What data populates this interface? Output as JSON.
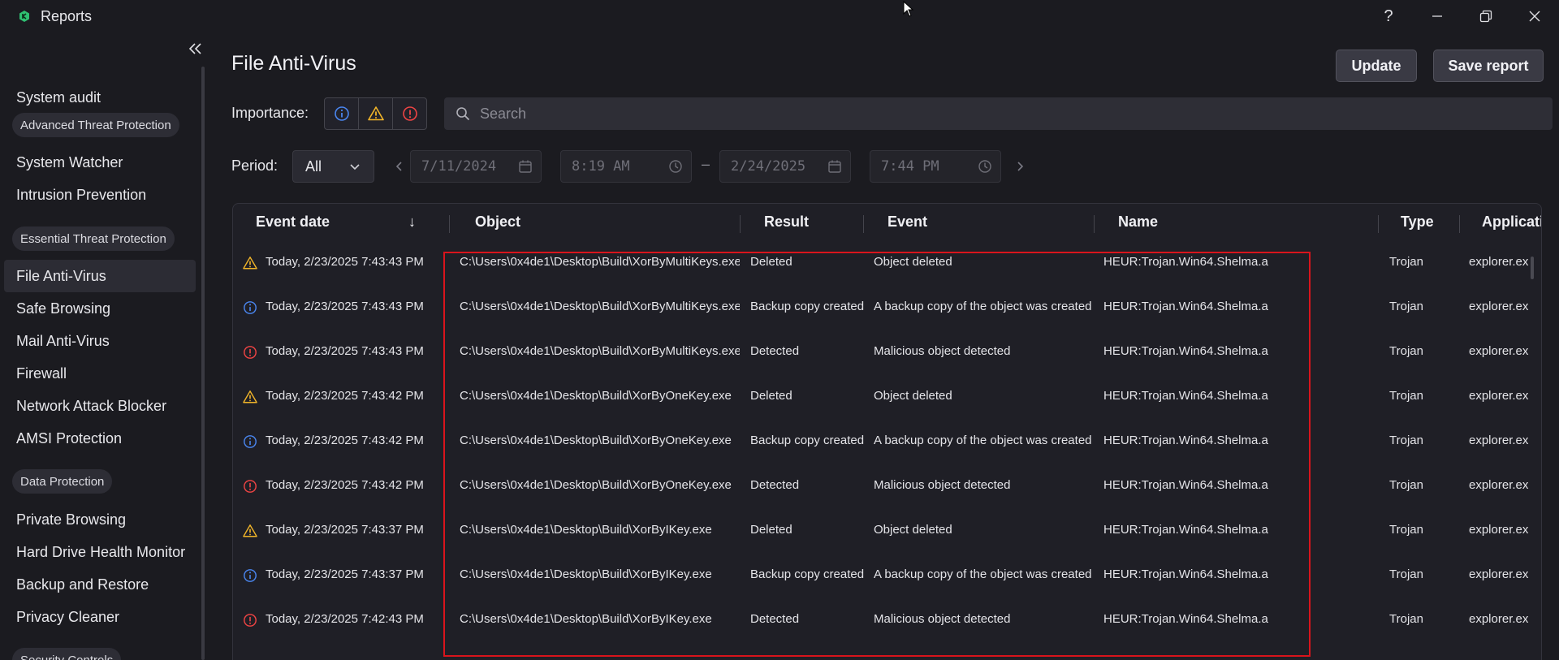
{
  "window": {
    "title": "Reports",
    "help_label": "?"
  },
  "sidebar": {
    "items": [
      {
        "label": "System audit"
      },
      {
        "section": "Advanced Threat Protection"
      },
      {
        "label": "System Watcher"
      },
      {
        "label": "Intrusion Prevention"
      },
      {
        "section": "Essential Threat Protection"
      },
      {
        "label": "File Anti-Virus",
        "active": true
      },
      {
        "label": "Safe Browsing"
      },
      {
        "label": "Mail Anti-Virus"
      },
      {
        "label": "Firewall"
      },
      {
        "label": "Network Attack Blocker"
      },
      {
        "label": "AMSI Protection"
      },
      {
        "section": "Data Protection"
      },
      {
        "label": "Private Browsing"
      },
      {
        "label": "Hard Drive Health Monitor"
      },
      {
        "label": "Backup and Restore"
      },
      {
        "label": "Privacy Cleaner"
      },
      {
        "section": "Security Controls"
      }
    ]
  },
  "main": {
    "title": "File Anti-Virus",
    "update_label": "Update",
    "save_report_label": "Save report",
    "importance_label": "Importance:",
    "search_placeholder": "Search",
    "period_label": "Period:",
    "period_value": "All",
    "date_from": "7/11/2024",
    "time_from": "8:19 AM",
    "date_separator": "–",
    "date_to": "2/24/2025",
    "time_to": "7:44 PM"
  },
  "table": {
    "columns": [
      "Event date",
      "Object",
      "Result",
      "Event",
      "Name",
      "Type",
      "Applicati"
    ],
    "sort_indicator": "↓",
    "rows": [
      {
        "level": "warning",
        "date": "Today, 2/23/2025 7:43:43 PM",
        "object": "C:\\Users\\0x4de1\\Desktop\\Build\\XorByMultiKeys.exe",
        "result": "Deleted",
        "event": "Object deleted",
        "name": "HEUR:Trojan.Win64.Shelma.a",
        "type": "Trojan",
        "app": "explorer.exe"
      },
      {
        "level": "info",
        "date": "Today, 2/23/2025 7:43:43 PM",
        "object": "C:\\Users\\0x4de1\\Desktop\\Build\\XorByMultiKeys.exe",
        "result": "Backup copy created",
        "event": "A backup copy of the object was created",
        "name": "HEUR:Trojan.Win64.Shelma.a",
        "type": "Trojan",
        "app": "explorer.exe"
      },
      {
        "level": "critical",
        "date": "Today, 2/23/2025 7:43:43 PM",
        "object": "C:\\Users\\0x4de1\\Desktop\\Build\\XorByMultiKeys.exe",
        "result": "Detected",
        "event": "Malicious object detected",
        "name": "HEUR:Trojan.Win64.Shelma.a",
        "type": "Trojan",
        "app": "explorer.exe"
      },
      {
        "level": "warning",
        "date": "Today, 2/23/2025 7:43:42 PM",
        "object": "C:\\Users\\0x4de1\\Desktop\\Build\\XorByOneKey.exe",
        "result": "Deleted",
        "event": "Object deleted",
        "name": "HEUR:Trojan.Win64.Shelma.a",
        "type": "Trojan",
        "app": "explorer.exe"
      },
      {
        "level": "info",
        "date": "Today, 2/23/2025 7:43:42 PM",
        "object": "C:\\Users\\0x4de1\\Desktop\\Build\\XorByOneKey.exe",
        "result": "Backup copy created",
        "event": "A backup copy of the object was created",
        "name": "HEUR:Trojan.Win64.Shelma.a",
        "type": "Trojan",
        "app": "explorer.exe"
      },
      {
        "level": "critical",
        "date": "Today, 2/23/2025 7:43:42 PM",
        "object": "C:\\Users\\0x4de1\\Desktop\\Build\\XorByOneKey.exe",
        "result": "Detected",
        "event": "Malicious object detected",
        "name": "HEUR:Trojan.Win64.Shelma.a",
        "type": "Trojan",
        "app": "explorer.exe"
      },
      {
        "level": "warning",
        "date": "Today, 2/23/2025 7:43:37 PM",
        "object": "C:\\Users\\0x4de1\\Desktop\\Build\\XorByIKey.exe",
        "result": "Deleted",
        "event": "Object deleted",
        "name": "HEUR:Trojan.Win64.Shelma.a",
        "type": "Trojan",
        "app": "explorer.exe"
      },
      {
        "level": "info",
        "date": "Today, 2/23/2025 7:43:37 PM",
        "object": "C:\\Users\\0x4de1\\Desktop\\Build\\XorByIKey.exe",
        "result": "Backup copy created",
        "event": "A backup copy of the object was created",
        "name": "HEUR:Trojan.Win64.Shelma.a",
        "type": "Trojan",
        "app": "explorer.exe"
      },
      {
        "level": "critical",
        "date": "Today, 2/23/2025 7:42:43 PM",
        "object": "C:\\Users\\0x4de1\\Desktop\\Build\\XorByIKey.exe",
        "result": "Detected",
        "event": "Malicious object detected",
        "name": "HEUR:Trojan.Win64.Shelma.a",
        "type": "Trojan",
        "app": "explorer.exe"
      }
    ]
  },
  "colors": {
    "background": "#1b1b20",
    "info": "#4a86f0",
    "warning": "#f0b429",
    "critical": "#ef4444",
    "highlight": "#d9141c",
    "logo": "#2fbf71"
  }
}
